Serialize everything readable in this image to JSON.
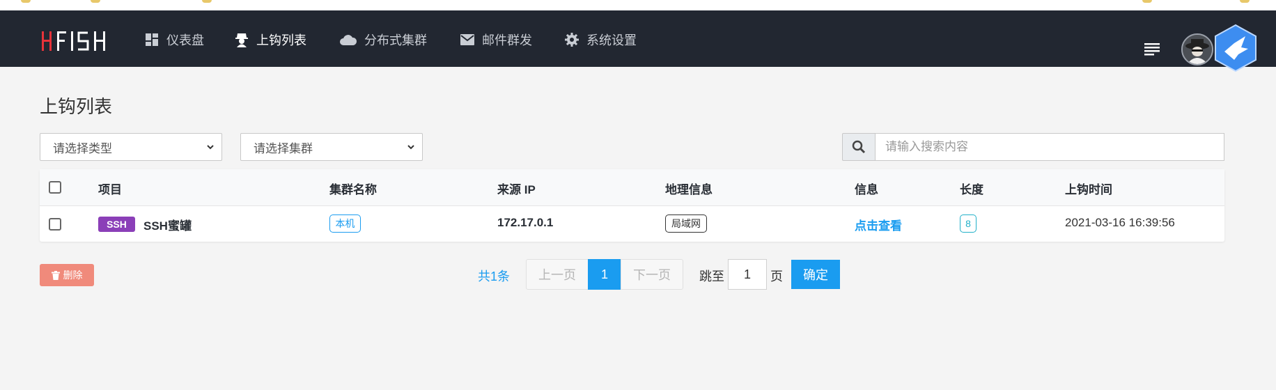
{
  "brand": {
    "logo_text": "HFISH"
  },
  "nav": {
    "items": [
      {
        "label": "仪表盘",
        "icon": "dashboard-icon"
      },
      {
        "label": "上钩列表",
        "icon": "hacker-icon"
      },
      {
        "label": "分布式集群",
        "icon": "cloud-icon"
      },
      {
        "label": "邮件群发",
        "icon": "mail-icon"
      },
      {
        "label": "系统设置",
        "icon": "gear-icon"
      }
    ],
    "active": "上钩列表"
  },
  "page": {
    "title": "上钩列表"
  },
  "filters": {
    "type_select": "请选择类型",
    "cluster_select": "请选择集群",
    "search_placeholder": "请输入搜索内容"
  },
  "table": {
    "headers": [
      "项目",
      "集群名称",
      "来源 IP",
      "地理信息",
      "信息",
      "长度",
      "上钩时间"
    ],
    "rows": [
      {
        "tag": "SSH",
        "project": "SSH蜜罐",
        "cluster": "本机",
        "source_ip": "172.17.0.1",
        "geo": "局域网",
        "info": "点击查看",
        "length": "8",
        "time": "2021-03-16 16:39:56"
      }
    ]
  },
  "actions": {
    "delete_label": "删除"
  },
  "pagination": {
    "total": "共1条",
    "prev": "上一页",
    "current": "1",
    "next": "下一页",
    "jump_to": "跳至",
    "jump_value": "1",
    "page_unit": "页",
    "confirm": "确定"
  },
  "colors": {
    "navbar": "#222731",
    "accent": "#1a9cf0",
    "ssh_tag": "#8b3fb8",
    "delete": "#f08a7b",
    "logo_red": "#e8333a"
  }
}
